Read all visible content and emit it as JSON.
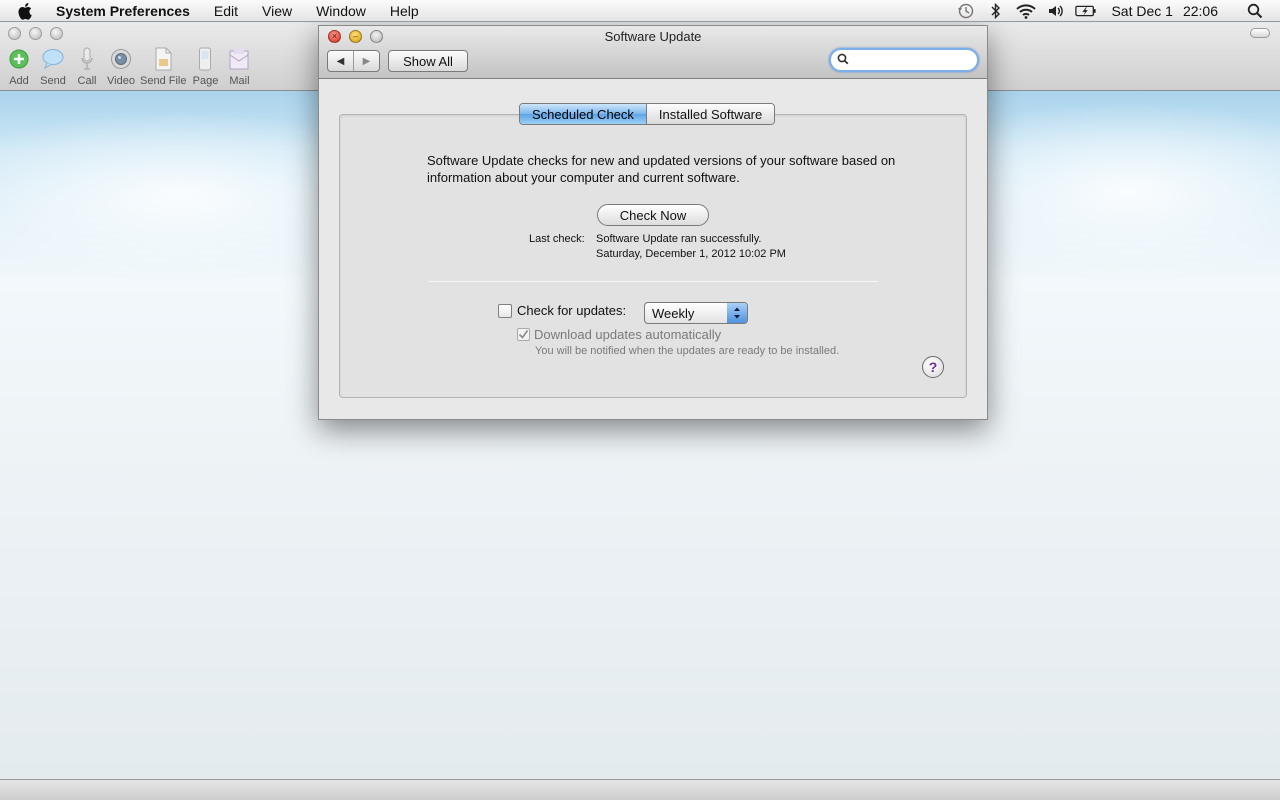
{
  "menubar": {
    "app_name": "System Preferences",
    "items": [
      "Edit",
      "View",
      "Window",
      "Help"
    ],
    "clock_date": "Sat Dec 1",
    "clock_time": "22:06",
    "status_icons": [
      "time-machine-icon",
      "bluetooth-icon",
      "wifi-icon",
      "volume-icon",
      "battery-icon",
      "spotlight-icon"
    ]
  },
  "background_app": {
    "toolbar": [
      {
        "label": "Add",
        "icon": "add-icon"
      },
      {
        "label": "Send",
        "icon": "chat-bubble-icon"
      },
      {
        "label": "Call",
        "icon": "microphone-icon"
      },
      {
        "label": "Video",
        "icon": "video-icon"
      },
      {
        "label": "Send File",
        "icon": "file-icon"
      },
      {
        "label": "Page",
        "icon": "phone-icon"
      },
      {
        "label": "Mail",
        "icon": "mail-icon"
      }
    ]
  },
  "window": {
    "title": "Software Update",
    "show_all": "Show All",
    "search_placeholder": ""
  },
  "tabs": [
    {
      "label": "Scheduled Check",
      "active": true
    },
    {
      "label": "Installed Software",
      "active": false
    }
  ],
  "scheduled": {
    "description": "Software Update checks for new and updated versions of your software based on information about your computer and current software.",
    "check_now": "Check Now",
    "last_check_label": "Last check:",
    "last_check_status": "Software Update ran successfully.",
    "last_check_date": "Saturday, December 1, 2012 10:02 PM",
    "check_for_updates_label": "Check for updates:",
    "check_for_updates_checked": false,
    "frequency": "Weekly",
    "download_auto_label": "Download updates automatically",
    "download_auto_checked": true,
    "download_auto_note": "You will be notified when the updates are ready to be installed."
  },
  "colors": {
    "accent_blue": "#5fa3e6",
    "close_red": "#d22a19",
    "minimize_yellow": "#d59a0e"
  }
}
